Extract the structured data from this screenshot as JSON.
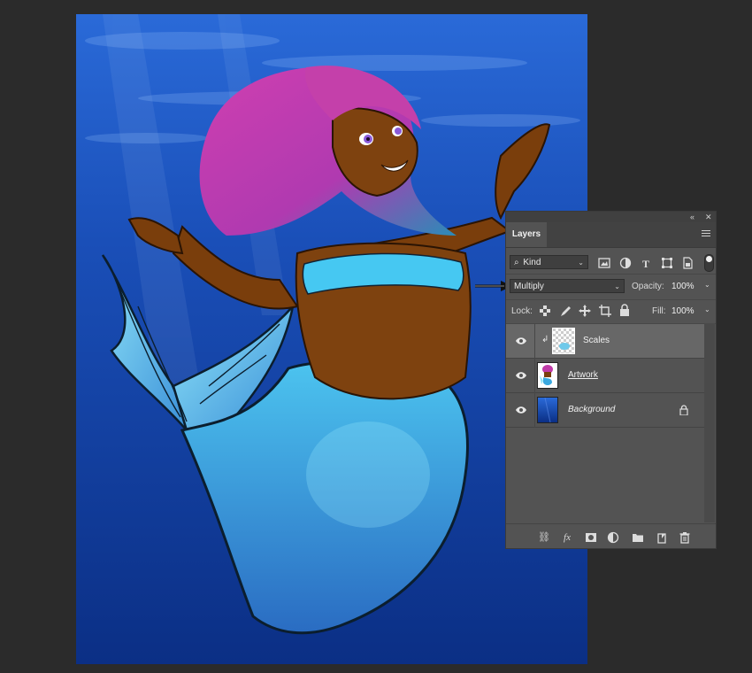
{
  "panel": {
    "tab_label": "Layers",
    "collapse_icon": "double-chevron-left-icon",
    "close_icon": "close-icon",
    "menu_icon": "hamburger-menu-icon"
  },
  "filter": {
    "kind_label": "Kind",
    "icons": [
      "image-filter-icon",
      "adjustment-filter-icon",
      "type-filter-icon",
      "shape-filter-icon",
      "smart-object-filter-icon",
      "filter-toggle-icon"
    ]
  },
  "blend": {
    "mode": "Multiply",
    "opacity_label": "Opacity:",
    "opacity_value": "100%"
  },
  "lock": {
    "label": "Lock:",
    "icons": [
      "lock-transparent-pixels-icon",
      "lock-image-pixels-icon",
      "lock-position-icon",
      "lock-artboard-icon",
      "lock-all-icon"
    ],
    "fill_label": "Fill:",
    "fill_value": "100%"
  },
  "layers": [
    {
      "name": "Scales",
      "selected": true,
      "clipped": true,
      "locked": false
    },
    {
      "name": "Artwork",
      "selected": false,
      "clipped": false,
      "locked": false
    },
    {
      "name": "Background",
      "selected": false,
      "clipped": false,
      "locked": true
    }
  ],
  "footer_icons": [
    "link-layers-icon",
    "fx-icon",
    "add-mask-icon",
    "adjustment-layer-icon",
    "new-group-folder-icon",
    "new-layer-icon",
    "trash-icon"
  ],
  "colors": {
    "panel_bg": "#535353",
    "selected_row": "#676767",
    "canvas_blue": "#1a4fb0",
    "hair_magenta": "#c0309a",
    "tail_cyan": "#3aa9e0"
  }
}
